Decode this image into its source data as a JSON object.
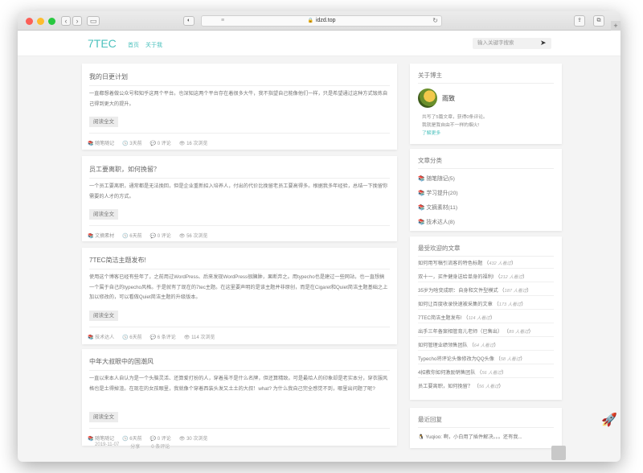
{
  "browser": {
    "url": "idzd.top"
  },
  "site": {
    "logo": "7TEC",
    "nav": [
      "首页",
      "关于我"
    ],
    "search_placeholder": "输入关键字搜索"
  },
  "posts": [
    {
      "title": "我的日更计划",
      "body": "一直都想着做公众号和知乎这两个平台。也深知这两个平台存在着很多大牛，我不指望自己能像他们一样，只是希望通过这种方式锻炼自己得到更大的提升。",
      "read": "阅读全文",
      "meta": [
        "随笔随记",
        "3天前",
        "0 评论",
        "16 次浏览"
      ]
    },
    {
      "title": "员工要离职，如何挽留？",
      "body": "一个员工要离职，通常都是无法挽回，但是企业重新招入培养人，付出的代价比挽留老员工要高得多。根据我多年经验，总结一下挽留你需要的人才的方式。",
      "read": "阅读全文",
      "meta": [
        "文摘素材",
        "6天前",
        "0 评论",
        "56 次浏览"
      ]
    },
    {
      "title": "7TEC简洁主题发布!",
      "body": "使用这个博客已经有些年了，之前用过WordPress、后来发现WordPress很臃肿，果断弃之。用typecho也是建过一些网站，也一直想搞一个属于自己的typecho风格。于是就有了现在的7tec主题。在这里要声明的是该主题并非原创，而是在Cigaret和Quiet简洁主题基础之上加以修改的，可以看做Quiet简洁主题的升级版本。",
      "read": "阅读全文",
      "meta": [
        "技术达人",
        "6天前",
        "6 条评论",
        "114 次浏览"
      ]
    },
    {
      "title": "中年大叔眼中的国潮风",
      "body": "一直以来本人自认为是一个头脑灵活、还算爱打扮的人，穿着虽不是什么名牌，但还算精致。可是最给人的印象却是老实本分，穿衣服风格也是土得掉渣。在现在的女孩眼里，我就像个穿着西装头发又土土的大叔！what? 为什么我自己完全感觉不到，哪里出问题了呢?",
      "read": "阅读全文",
      "meta": [
        "随笔随记",
        "6天前",
        "0 评论",
        "30 次浏览"
      ]
    }
  ],
  "sidebar": {
    "about_title": "关于博主",
    "author": "雨致",
    "about_line1": "共写了5篇文章，获得0条评论。",
    "about_line2": "我就是我自由不一样的烟火!",
    "about_more": "了解更多",
    "cat_title": "文章分类",
    "categories": [
      "随笔随记(5)",
      "学习提升(20)",
      "文摘素材(11)",
      "技术达人(8)"
    ],
    "popular_title": "最受欢迎的文章",
    "popular": [
      {
        "title": "如何用写稿引流客的特色标题",
        "views": "432 人看过"
      },
      {
        "title": "双十一，买件健身送给单身的福利!",
        "views": "212 人看过"
      },
      {
        "title": "35岁为啥变成职：自身和文件型模式",
        "views": "187 人看过"
      },
      {
        "title": "如何让百度收录快速被采集的文章",
        "views": "173 人看过"
      },
      {
        "title": "7TEC简洁主题发布!",
        "views": "114 人看过"
      },
      {
        "title": "出手三年备案相管育儿老师（已售出）",
        "views": "89 人看过"
      },
      {
        "title": "如何管理业绩领售团队",
        "views": "64 人看过"
      },
      {
        "title": "Typecho将评论头像修改为QQ头像",
        "views": "58 人看过"
      },
      {
        "title": "4招教你如何激励销售团队",
        "views": "56 人看过"
      },
      {
        "title": "员工要离职，如何挽留？",
        "views": "56 人看过"
      }
    ],
    "recent_title": "最近回复",
    "recent": "Yuqioo: 啊，小白用了插件解决。。。还有我..."
  },
  "footer_meta": [
    "2019-11-07",
    "分享",
    "0 条评论"
  ]
}
